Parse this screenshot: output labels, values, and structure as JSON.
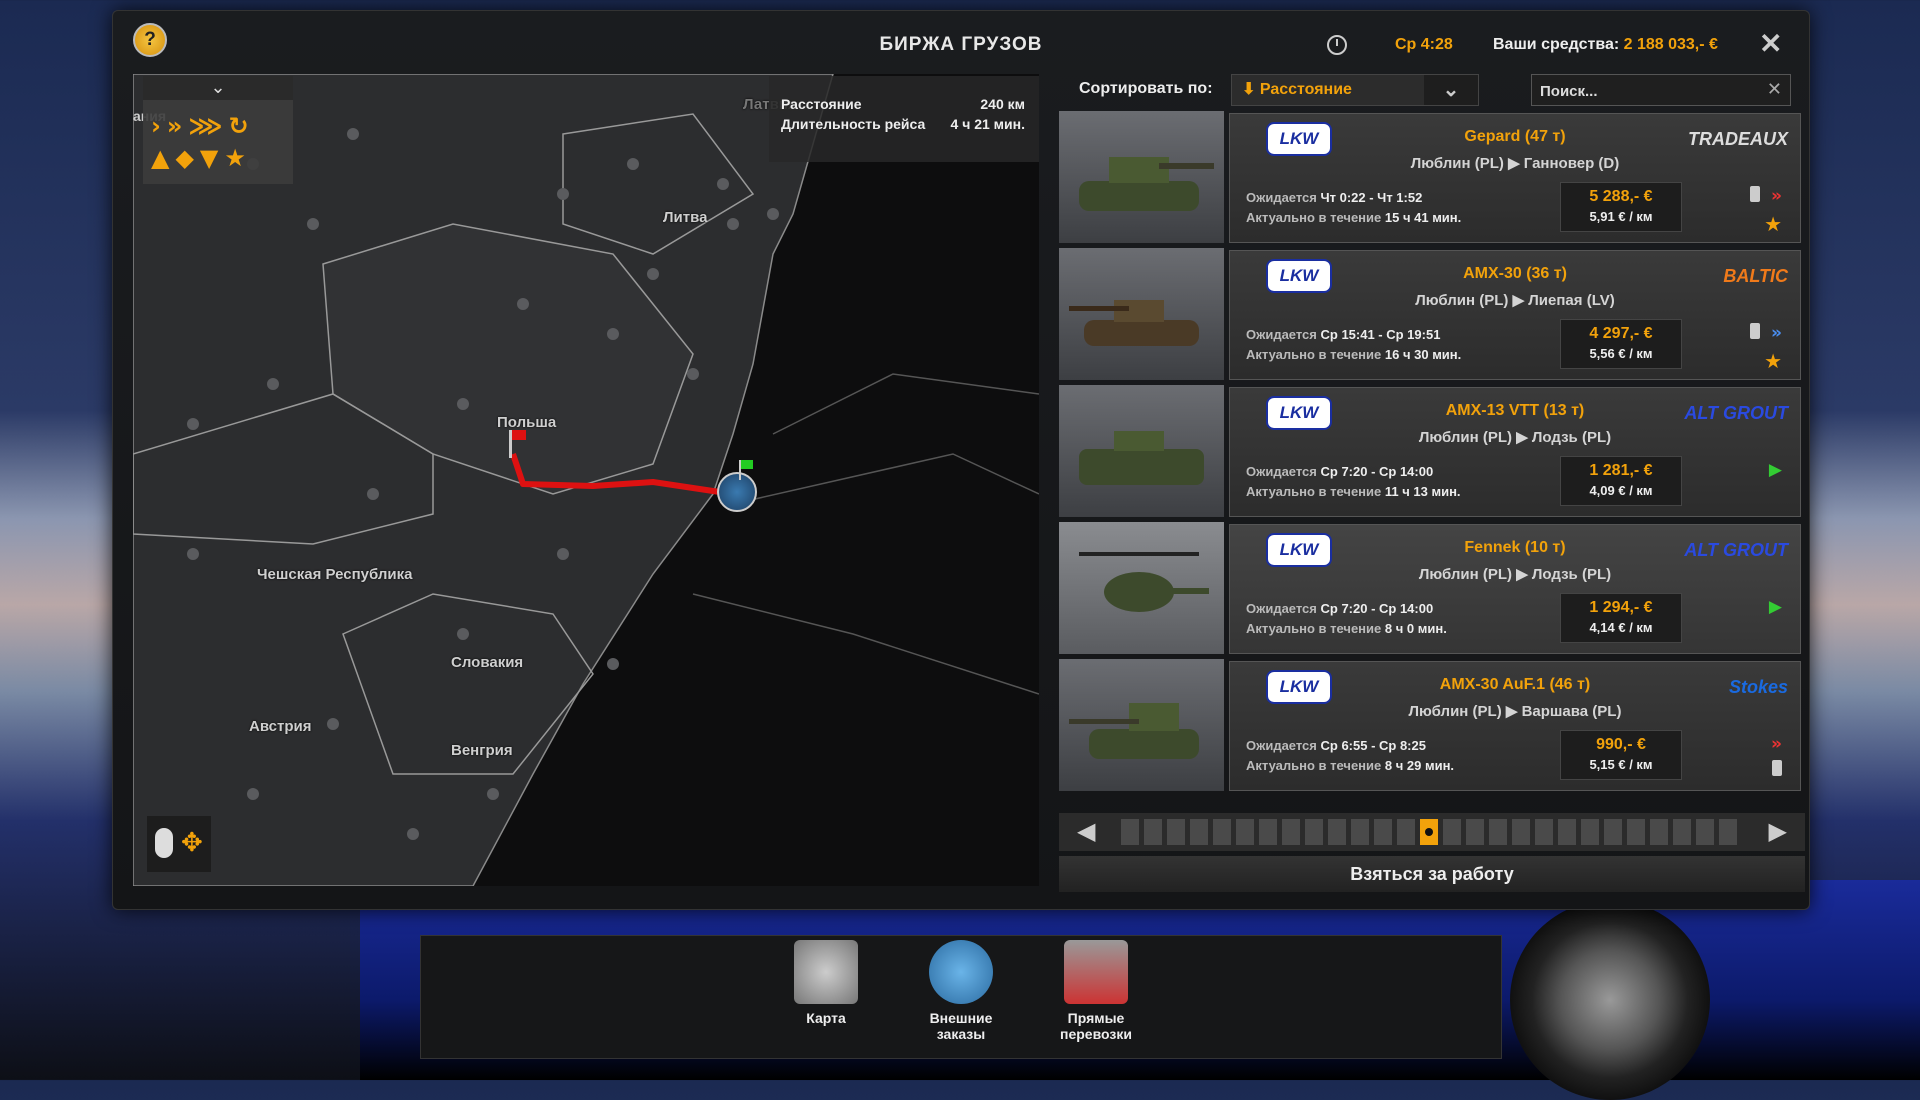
{
  "window": {
    "title": "БИРЖА ГРУЗОВ",
    "time": "Ср 4:28",
    "funds_label": "Ваши средства:",
    "funds_value": "2 188 033,- €"
  },
  "map": {
    "partial_label": "ания",
    "info": {
      "distance_label": "Расстояние",
      "distance_value": "240 км",
      "duration_label": "Длительность рейса",
      "duration_value": "4 ч 21 мин."
    },
    "labels": {
      "latvia": "Латвия",
      "lithuania": "Литва",
      "poland": "Польша",
      "czech": "Чешская Республика",
      "slovakia": "Словакия",
      "austria": "Австрия",
      "hungary": "Венгрия"
    }
  },
  "sort": {
    "label": "Сортировать по:",
    "value": "Расстояние"
  },
  "search": {
    "placeholder": "Поиск..."
  },
  "jobs": [
    {
      "company": "LKW",
      "cargo": "Gepard (47 т)",
      "route": "Люблин (PL) ▶ Ганновер (D)",
      "wait_label": "Ожидается",
      "wait": "Чт 0:22 - Чт 1:52",
      "valid_label": "Актуально в течение",
      "valid": "15 ч 41 мин.",
      "price": "5 288,- €",
      "per_km": "5,91 € / км",
      "brand": "TRADEAUX"
    },
    {
      "company": "LKW",
      "cargo": "AMX-30 (36 т)",
      "route": "Люблин (PL) ▶ Лиепая (LV)",
      "wait_label": "Ожидается",
      "wait": "Ср 15:41 - Ср 19:51",
      "valid_label": "Актуально в течение",
      "valid": "16 ч 30 мин.",
      "price": "4 297,- €",
      "per_km": "5,56 € / км",
      "brand": "BALTIC"
    },
    {
      "company": "LKW",
      "cargo": "AMX-13 VTT (13 т)",
      "route": "Люблин (PL) ▶ Лодзь (PL)",
      "wait_label": "Ожидается",
      "wait": "Ср 7:20 - Ср 14:00",
      "valid_label": "Актуально в течение",
      "valid": "11 ч 13 мин.",
      "price": "1 281,- €",
      "per_km": "4,09 € / км",
      "brand": "ALT GROUT"
    },
    {
      "company": "LKW",
      "cargo": "Fennek (10 т)",
      "route": "Люблин (PL) ▶ Лодзь (PL)",
      "wait_label": "Ожидается",
      "wait": "Ср 7:20 - Ср 14:00",
      "valid_label": "Актуально в течение",
      "valid": "8 ч 0 мин.",
      "price": "1 294,- €",
      "per_km": "4,14 € / км",
      "brand": "ALT GROUT"
    },
    {
      "company": "LKW",
      "cargo": "AMX-30 AuF.1 (46 т)",
      "route": "Люблин (PL) ▶ Варшава (PL)",
      "wait_label": "Ожидается",
      "wait": "Ср 6:55 - Ср 8:25",
      "valid_label": "Актуально в течение",
      "valid": "8 ч 29 мин.",
      "price": "990,- €",
      "per_km": "5,15 € / км",
      "brand": "Stokes"
    }
  ],
  "take_button": "Взяться за работу",
  "dock": [
    {
      "label": "Карта"
    },
    {
      "label": "Внешние заказы"
    },
    {
      "label": "Прямые перевозки"
    }
  ],
  "colors": {
    "accent": "#f2a20b",
    "lkw_blue": "#1a2ea0",
    "route_red": "#d11"
  }
}
